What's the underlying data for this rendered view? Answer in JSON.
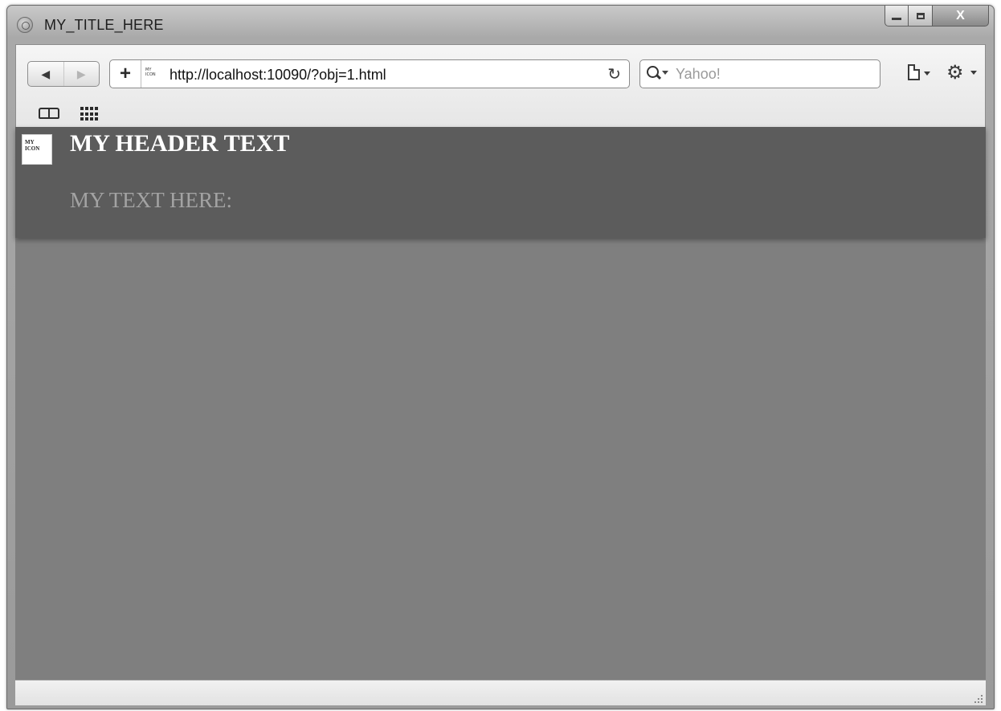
{
  "window": {
    "title": "MY_TITLE_HERE",
    "controls": {
      "minimize": "minimize",
      "maximize": "maximize",
      "close": "X"
    }
  },
  "toolbar": {
    "back_icon": "◀",
    "forward_icon": "▶",
    "add_tab_icon": "+",
    "favicon_text": [
      "MY",
      "ICON"
    ],
    "url": "http://localhost:10090/?obj=1.html",
    "reload_icon": "↻",
    "search": {
      "placeholder": "Yahoo!",
      "value": ""
    },
    "icons": [
      "back-icon",
      "forward-icon",
      "plus-icon",
      "reload-icon",
      "search-icon",
      "page-menu-icon",
      "gear-icon",
      "bookmarks-icon",
      "top-sites-icon"
    ]
  },
  "page": {
    "icon_text": [
      "MY",
      "ICON"
    ],
    "header": "MY HEADER TEXT",
    "text": "MY TEXT HERE:"
  },
  "colors": {
    "header_background": "#5c5c5c",
    "content_background": "#7f7f7f",
    "header_text": "#ffffff",
    "body_text": "#a3a3a3"
  }
}
